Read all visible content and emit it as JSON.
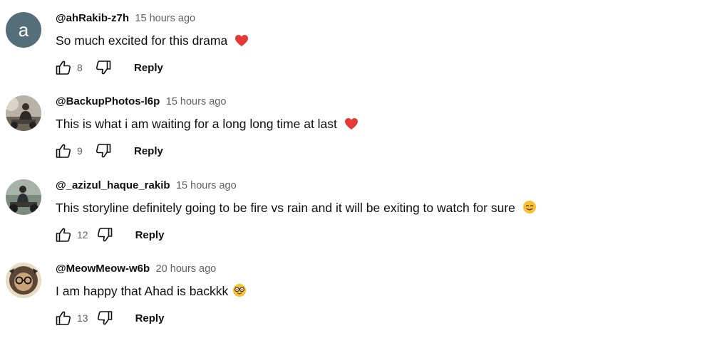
{
  "comments": [
    {
      "author": "@ahRakib-z7h",
      "time": "15 hours ago",
      "text": "So much excited for this drama",
      "emoji": "red-heart",
      "likes": "8",
      "reply_label": "Reply",
      "avatar_letter": "a",
      "avatar_color": "#546e7a"
    },
    {
      "author": "@BackupPhotos-l6p",
      "time": "15 hours ago",
      "text": "This is what i am waiting for a long long time at last",
      "emoji": "red-heart",
      "likes": "9",
      "reply_label": "Reply"
    },
    {
      "author": "@_azizul_haque_rakib",
      "time": "15 hours ago",
      "text": "This storyline definitely going to be fire vs rain and it will be exiting to watch for sure",
      "emoji": "smiling-face",
      "likes": "12",
      "reply_label": "Reply"
    },
    {
      "author": "@MeowMeow-w6b",
      "time": "20 hours ago",
      "text": "I am happy that Ahad is backkk",
      "emoji": "nerd-face",
      "likes": "13",
      "reply_label": "Reply"
    }
  ]
}
